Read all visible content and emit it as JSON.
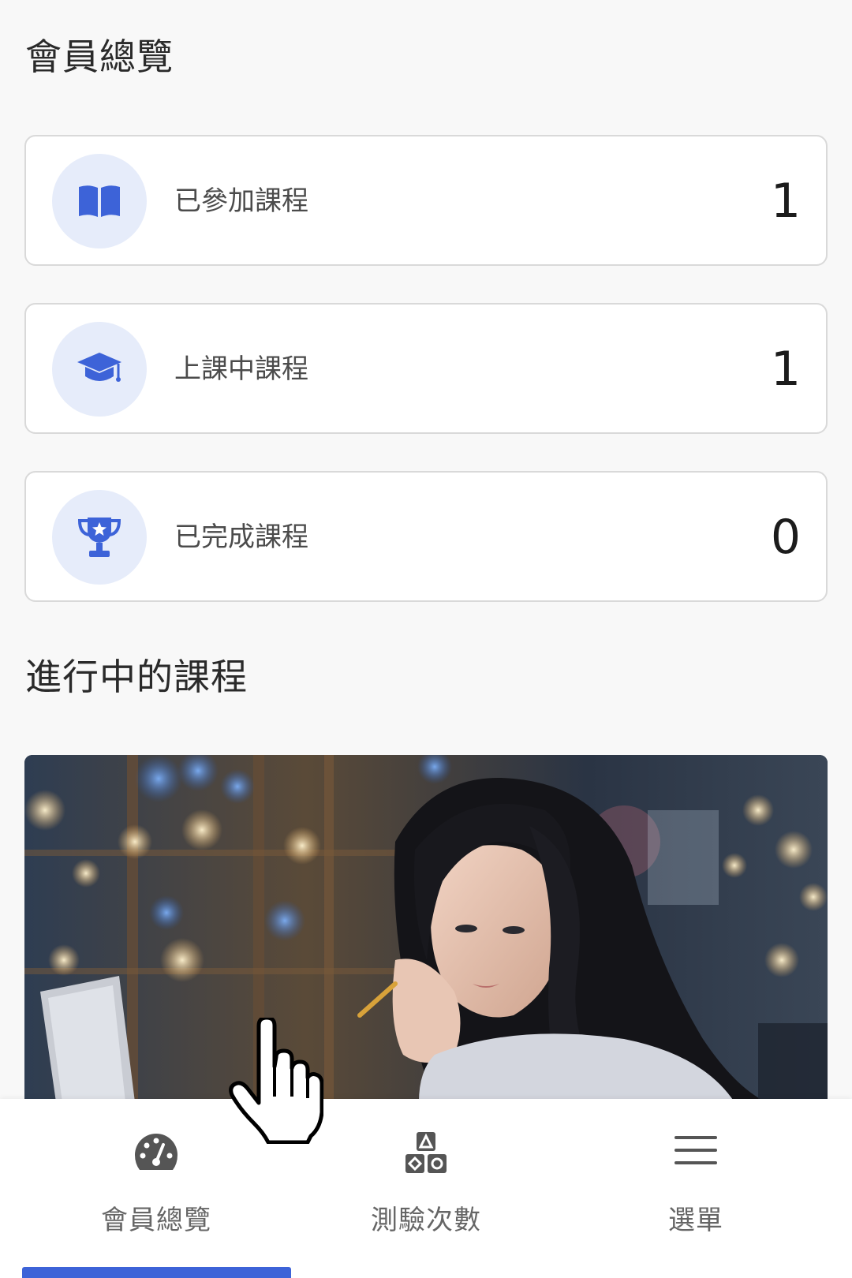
{
  "overview": {
    "title": "會員總覽"
  },
  "stats": [
    {
      "label": "已參加課程",
      "value": "1",
      "icon": "open-book-icon"
    },
    {
      "label": "上課中課程",
      "value": "1",
      "icon": "graduation-cap-icon"
    },
    {
      "label": "已完成課程",
      "value": "0",
      "icon": "trophy-icon"
    }
  ],
  "in_progress": {
    "title": "進行中的課程"
  },
  "bottom_nav": {
    "items": [
      {
        "label": "會員總覽",
        "icon": "dashboard-gauge-icon",
        "active": true
      },
      {
        "label": "測驗次數",
        "icon": "shapes-blocks-icon",
        "active": false
      },
      {
        "label": "選單",
        "icon": "hamburger-menu-icon",
        "active": false
      }
    ]
  },
  "colors": {
    "accent": "#3d63d8",
    "icon_circle_bg": "#e6ecfa",
    "nav_icon": "#555555",
    "page_bg": "#f8f8f8"
  }
}
